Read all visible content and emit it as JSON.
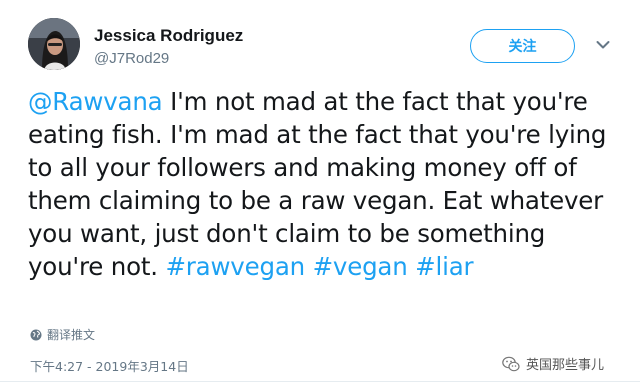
{
  "author": {
    "display_name": "Jessica Rodriguez",
    "handle": "@J7Rod29"
  },
  "follow_label": "关注",
  "tweet": {
    "segments": [
      {
        "text": "@Rawvana",
        "type": "mention"
      },
      {
        "text": " I'm not mad at the fact that you're eating fish. I'm mad at the fact that you're lying to all your followers and making money off of them claiming to be a raw vegan. Eat whatever you want, just don't claim to be something you're not. ",
        "type": "text"
      },
      {
        "text": "#rawvegan",
        "type": "hashtag"
      },
      {
        "text": " ",
        "type": "text"
      },
      {
        "text": "#vegan",
        "type": "hashtag"
      },
      {
        "text": " ",
        "type": "text"
      },
      {
        "text": "#liar",
        "type": "hashtag"
      }
    ]
  },
  "translate_label": "翻译推文",
  "timestamp": "下午4:27 - 2019年3月14日",
  "watermark_text": "英国那些事儿",
  "icons": {
    "avatar": "avatar-photo",
    "caret": "chevron-down-icon",
    "translate": "globe-icon",
    "watermark": "wechat-icon"
  },
  "colors": {
    "link": "#1da1f2",
    "secondary": "#657786",
    "text": "#14171a"
  }
}
